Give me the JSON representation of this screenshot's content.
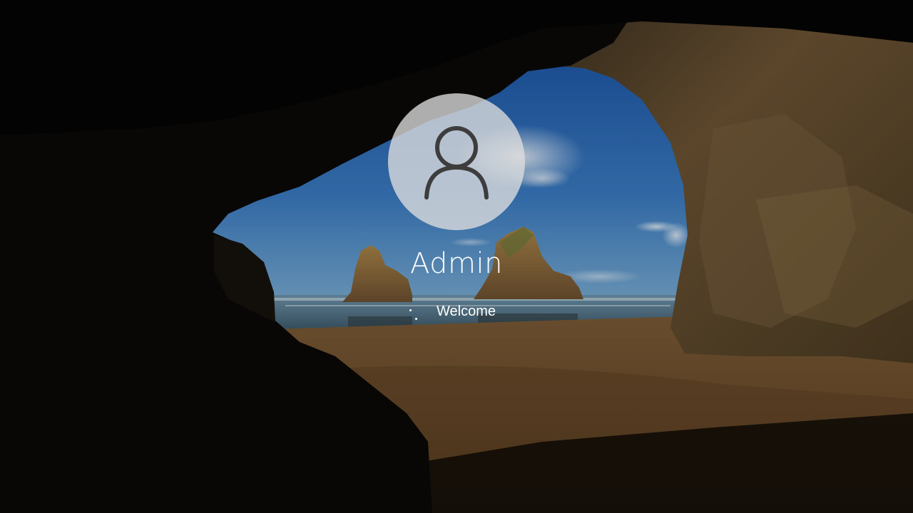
{
  "screen": {
    "type": "lock-screen-sign-in",
    "background": "cave-beach-wallpaper"
  },
  "user": {
    "name": "Admin",
    "avatar_icon": "user-silhouette-icon"
  },
  "status": {
    "text": "Welcome",
    "indicator_icon": "loading-dots-icon"
  },
  "colors": {
    "text": "#ffffff",
    "avatar_bg": "#dedede",
    "avatar_icon": "#3d3d3d"
  }
}
